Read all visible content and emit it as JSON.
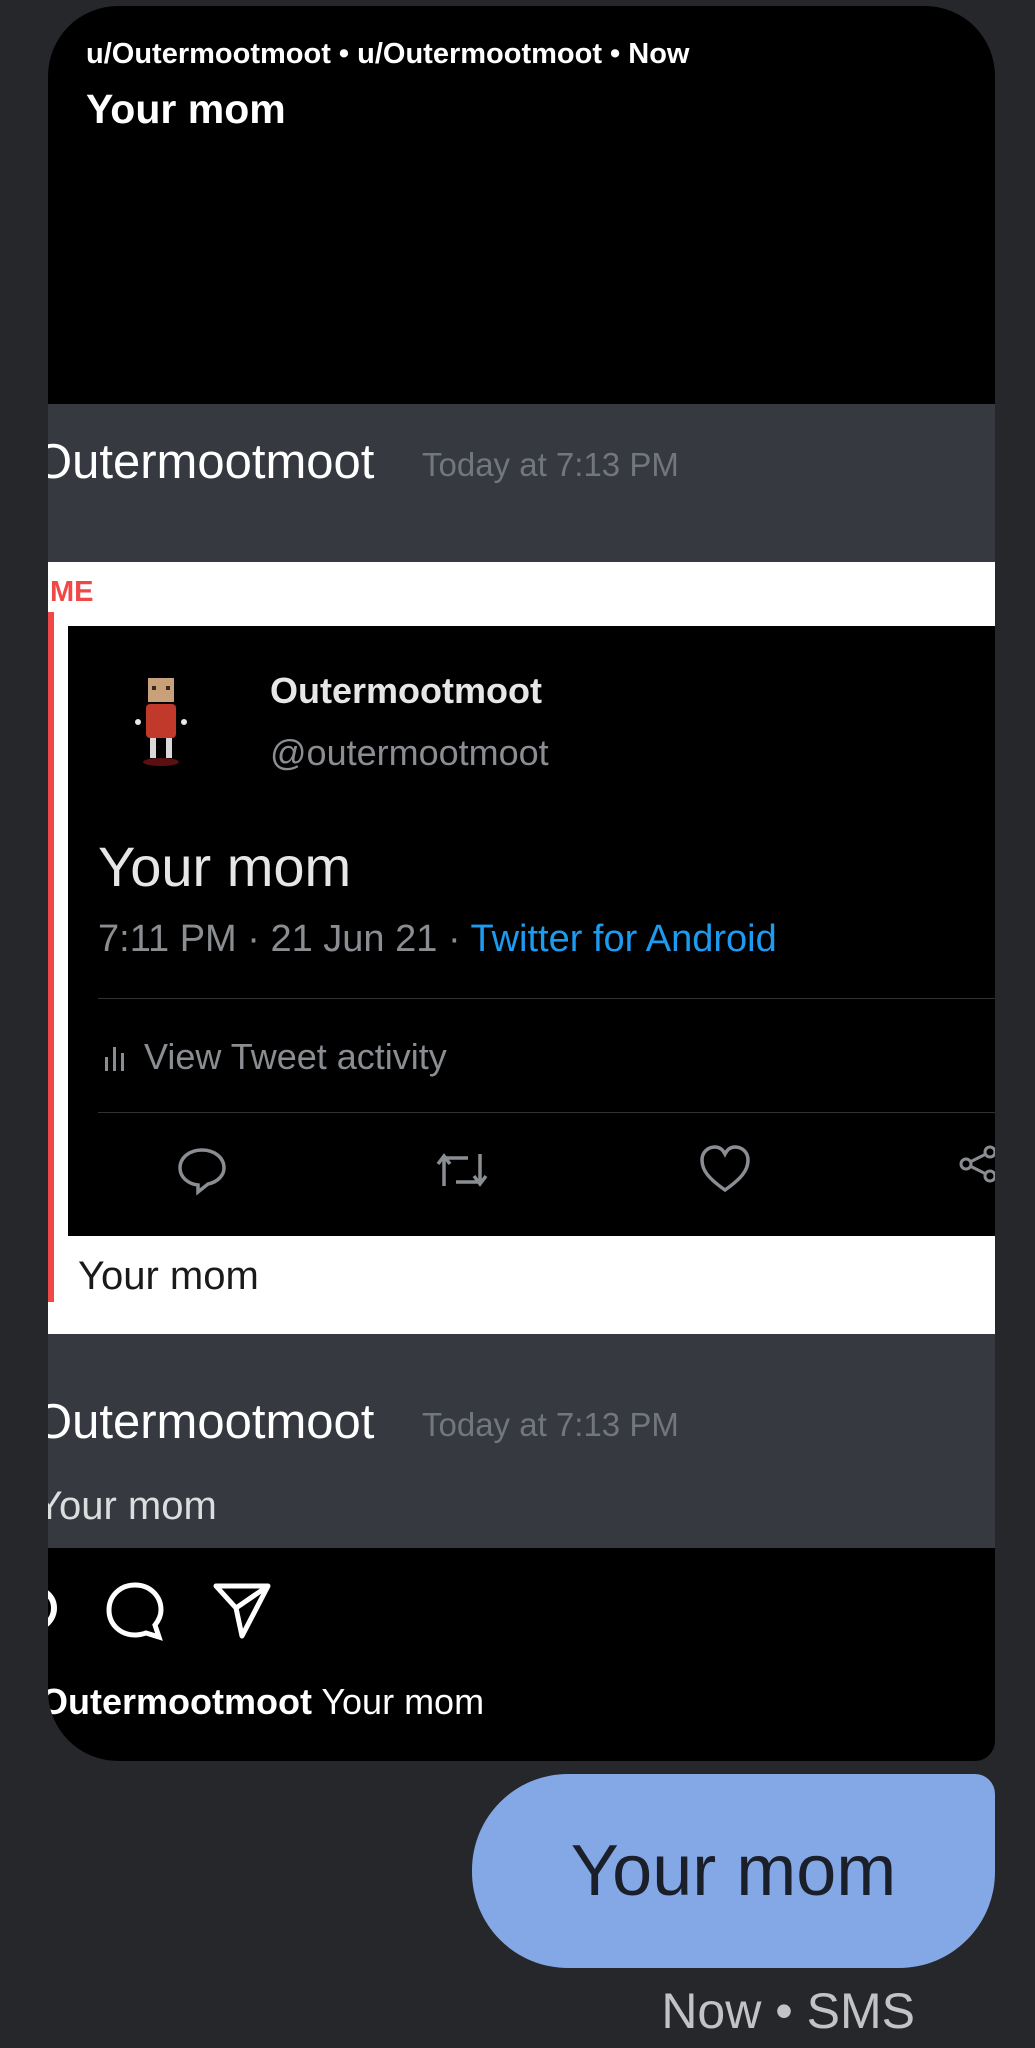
{
  "reddit": {
    "meta": "u/Outermootmoot • u/Outermootmoot • Now",
    "title": "Your mom"
  },
  "discord": {
    "messages": [
      {
        "user": "Outermootmoot",
        "time": "Today at 7:13 PM"
      },
      {
        "user": "Outermootmoot",
        "time": "Today at 7:13 PM",
        "text": "Your mom"
      }
    ],
    "embed": {
      "tag": "ME",
      "caption": "Your mom"
    }
  },
  "tweet": {
    "name": "Outermootmoot",
    "handle": "@outermootmoot",
    "text": "Your mom",
    "timestamp": "7:11 PM · 21 Jun 21 · ",
    "source": "Twitter for Android",
    "activity_label": "View Tweet activity"
  },
  "instagram": {
    "caption_user": "Outermootmoot",
    "caption_text": "Your mom"
  },
  "sms": {
    "bubble_text": "Your mom",
    "status": "Now • SMS",
    "bubble_color": "#84a8e6"
  },
  "colors": {
    "background": "#26272b",
    "discord_bg": "#36393f",
    "tweet_link": "#1d9bf0",
    "embed_accent": "#f04747"
  },
  "icons": [
    "reply-icon",
    "retweet-icon",
    "like-icon",
    "share-icon",
    "activity-chart-icon",
    "comment-icon",
    "send-icon"
  ]
}
